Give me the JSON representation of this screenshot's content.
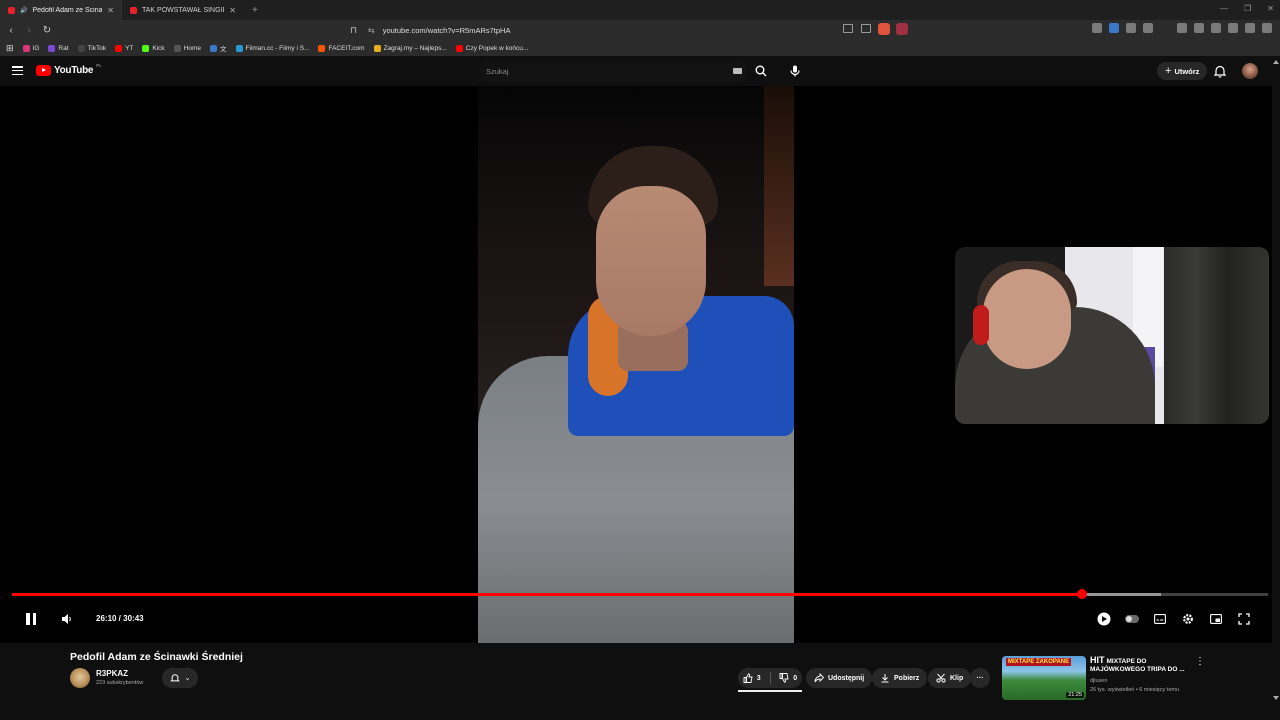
{
  "browser": {
    "tabs": [
      {
        "title": "Pedofil Adam ze Ścinawki Śr",
        "active": true
      },
      {
        "title": "TAK POWSTAWAŁ SINGIEL \"OBOK\"!",
        "active": false
      }
    ],
    "url": "youtube.com/watch?v=R5mARs7tpHA",
    "bookmarks": [
      {
        "label": "IG",
        "color": "#d6367a"
      },
      {
        "label": "Rat",
        "color": "#7a4ad6"
      },
      {
        "label": "TikTok",
        "color": "#111111"
      },
      {
        "label": "YT",
        "color": "#ff0000"
      },
      {
        "label": "Kick",
        "color": "#53fc18"
      },
      {
        "label": "Home",
        "color": "#333333"
      },
      {
        "label": "文",
        "color": "#3a78c8"
      },
      {
        "label": "Filman.cc - Filmy i S...",
        "color": "#2a9ad6"
      },
      {
        "label": "FACEIT.com",
        "color": "#ff5500"
      },
      {
        "label": "Zagraj.my – Najleps...",
        "color": "#e8b020"
      },
      {
        "label": "Czy Popek w końcu...",
        "color": "#ff0000"
      }
    ]
  },
  "header": {
    "logo": "YouTube",
    "country": "PL",
    "search_placeholder": "Szukaj",
    "create_label": "Utwórz"
  },
  "player": {
    "time": "26:10 / 30:43",
    "progress_fraction": 0.852,
    "buffered_fraction": 0.915
  },
  "video": {
    "title": "Pedofil Adam ze Ścinawki Średniej",
    "channel": "R3PKAZ",
    "subscribers": "223 subskrybentów",
    "likes": "3",
    "dislikes": "0",
    "share_label": "Udostępnij",
    "download_label": "Pobierz",
    "clip_label": "Klip"
  },
  "recommended": {
    "thumb_tag": "MIXTAPE ZAKOPANE",
    "hit": "HIT",
    "title": "MIXTAPE DO MAJÓWKOWEGO TRIPA DO ...",
    "channel": "djlusen",
    "meta": "26 tys. wyświetleń • 6 miesięcy temu",
    "duration": "21:25"
  }
}
